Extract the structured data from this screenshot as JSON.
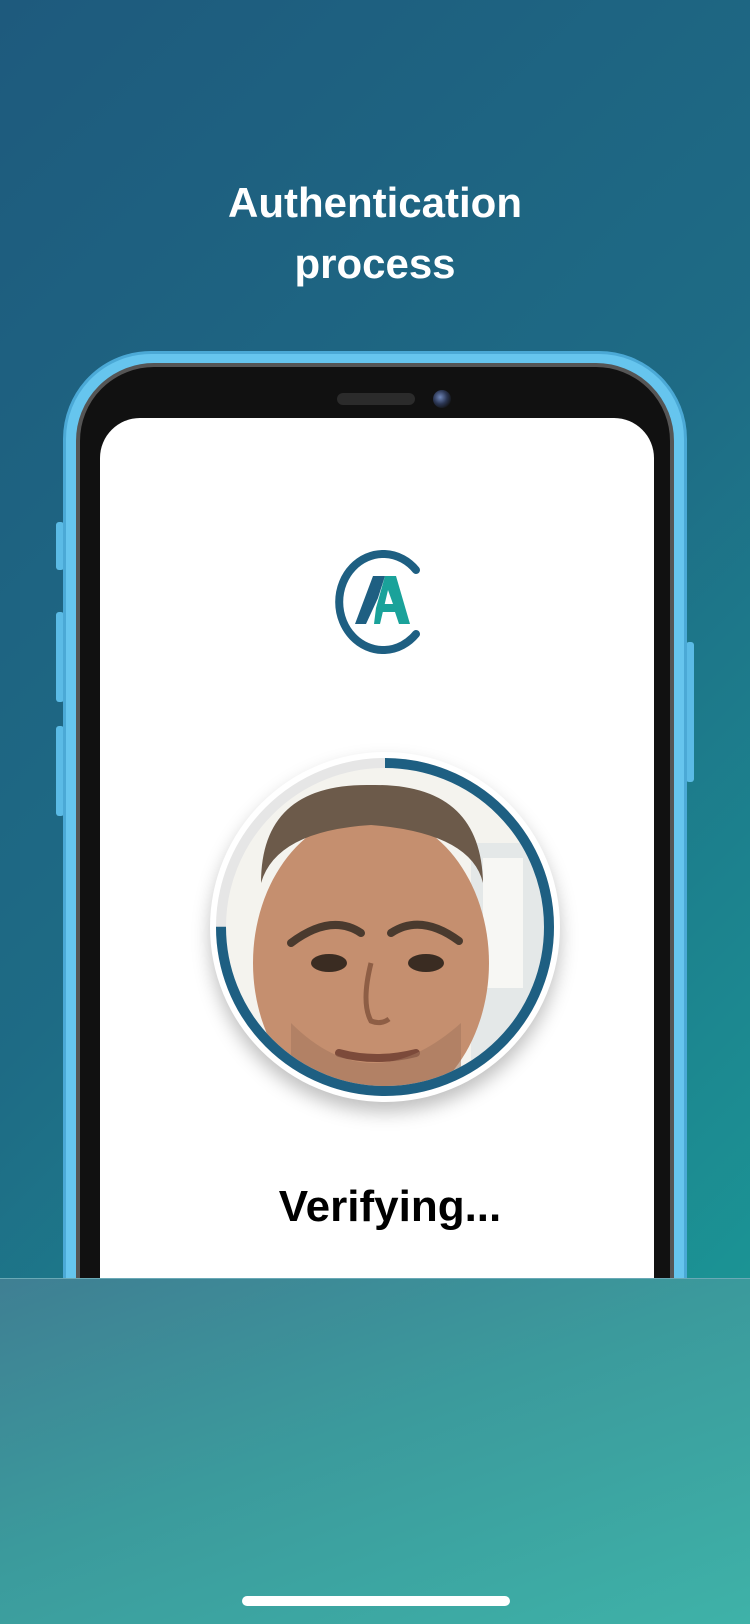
{
  "header": {
    "title_line1": "Authentication",
    "title_line2": "process"
  },
  "app": {
    "logo_icon": "ca-logo-icon",
    "status_text": "Verifying...",
    "verification_progress": 0.75
  },
  "colors": {
    "background_start": "#1e5a7d",
    "background_end": "#1aa29a",
    "brand_dark": "#1e5f82",
    "brand_teal": "#1aa29a",
    "ring_track": "#e6e6e6",
    "phone_frame": "#66c5ee"
  }
}
